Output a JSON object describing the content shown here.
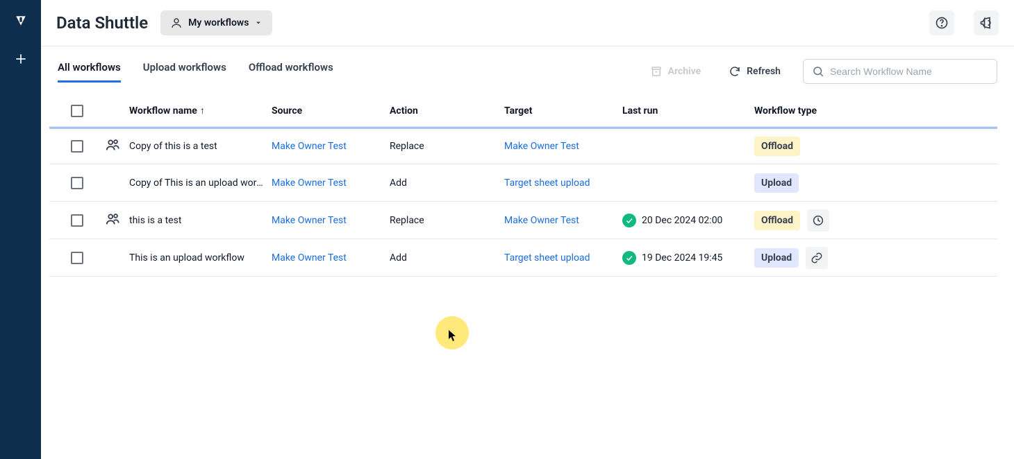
{
  "header": {
    "title": "Data Shuttle",
    "dropdown_label": "My workflows"
  },
  "toolbar": {
    "tabs": [
      {
        "label": "All workflows",
        "active": true
      },
      {
        "label": "Upload workflows",
        "active": false
      },
      {
        "label": "Offload workflows",
        "active": false
      }
    ],
    "archive_label": "Archive",
    "refresh_label": "Refresh",
    "search_placeholder": "Search Workflow Name"
  },
  "table": {
    "columns": {
      "name": "Workflow name",
      "source": "Source",
      "action": "Action",
      "target": "Target",
      "lastrun": "Last run",
      "type": "Workflow type"
    },
    "rows": [
      {
        "shared": true,
        "name": "Copy of this is a test",
        "source": "Make Owner Test",
        "action": "Replace",
        "target": "Make Owner Test",
        "target_link": true,
        "lastrun": "",
        "status": null,
        "type": "Offload",
        "extra_icon": null
      },
      {
        "shared": false,
        "name": "Copy of This is an upload workflow",
        "source": "Make Owner Test",
        "action": "Add",
        "target": "Target sheet upload",
        "target_link": true,
        "lastrun": "",
        "status": null,
        "type": "Upload",
        "extra_icon": null
      },
      {
        "shared": true,
        "name": "this is a test",
        "source": "Make Owner Test",
        "action": "Replace",
        "target": "Make Owner Test",
        "target_link": true,
        "lastrun": "20 Dec 2024 02:00",
        "status": "ok",
        "type": "Offload",
        "extra_icon": "clock"
      },
      {
        "shared": false,
        "name": "This is an upload workflow",
        "source": "Make Owner Test",
        "action": "Add",
        "target": "Target sheet upload",
        "target_link": true,
        "lastrun": "19 Dec 2024 19:45",
        "status": "ok",
        "type": "Upload",
        "extra_icon": "link"
      }
    ]
  },
  "badges": {
    "Offload": "badge-offload",
    "Upload": "badge-upload"
  }
}
